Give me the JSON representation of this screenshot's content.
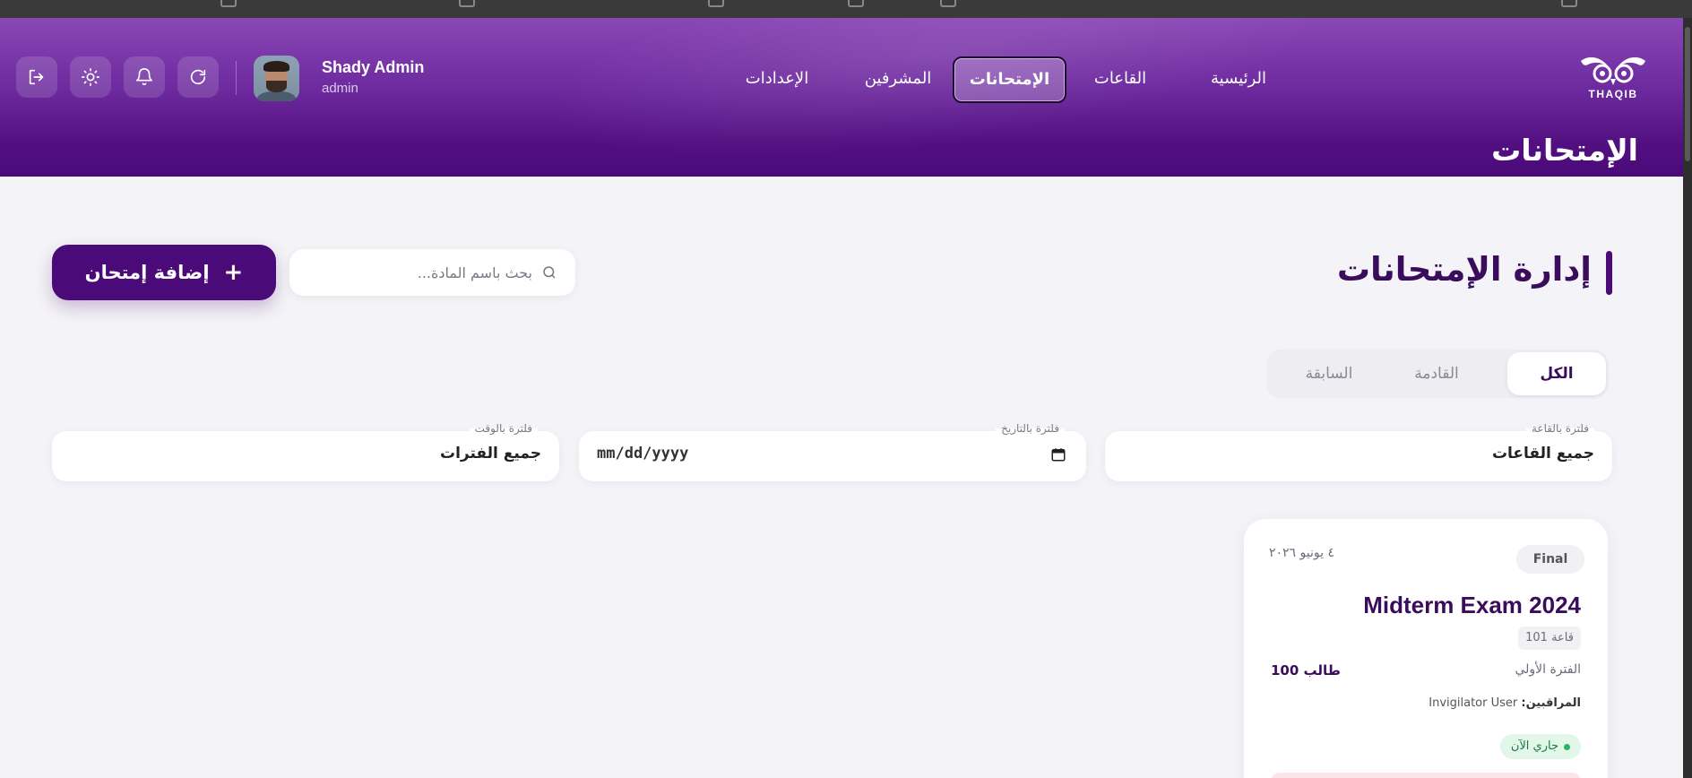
{
  "header": {
    "user": {
      "name": "Shady Admin",
      "role": "admin"
    },
    "nav": [
      {
        "label": "الرئيسية"
      },
      {
        "label": "القاعات"
      },
      {
        "label": "الإمتحانات",
        "active": true
      },
      {
        "label": "المشرفين"
      },
      {
        "label": "الإعدادات"
      }
    ],
    "logo_text": "THAQIB",
    "page_heading": "الإمتحانات",
    "icons": [
      "logout-icon",
      "sun-icon",
      "bell-icon",
      "refresh-icon"
    ]
  },
  "main": {
    "title": "إدارة الإمتحانات",
    "add_button": "إضافة إمتحان",
    "search_placeholder": "بحث باسم المادة...",
    "tabs": [
      {
        "label": "الكل",
        "active": true
      },
      {
        "label": "القادمة"
      },
      {
        "label": "السابقة"
      }
    ],
    "filters": {
      "room": {
        "label": "فلترة بالقاعة",
        "value": "جميع القاعات"
      },
      "date": {
        "label": "فلترة بالتاريخ",
        "value": "mm/dd/yyyy"
      },
      "time": {
        "label": "فلترة بالوقت",
        "value": "جميع الفترات"
      }
    }
  },
  "exam_card": {
    "type_badge": "Final",
    "date": "٤ يونيو ٢٠٢٦",
    "title": "Midterm Exam 2024",
    "room": "قاعة 101",
    "period": "الفترة الأولي",
    "students": "100 طالب",
    "invigilators_label": "المراقبين:",
    "invigilators_value": "Invigilator User",
    "status": "جاري الآن"
  },
  "colors": {
    "primary": "#4a0a78",
    "header_gradient_top": "#8a47b5",
    "page_bg": "#f4f3f7",
    "status_green": "#28b463"
  }
}
